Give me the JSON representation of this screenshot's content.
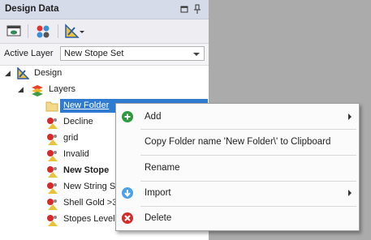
{
  "panel": {
    "title": "Design Data",
    "pin_icon": "pin-icon",
    "restore_icon": "restore-icon"
  },
  "toolbar": {
    "buttons": [
      "view-icon",
      "palette-icon",
      "design-tools-dropdown-icon"
    ]
  },
  "active_layer": {
    "label": "Active Layer",
    "value": "New Stope Set"
  },
  "tree": {
    "root": "Design",
    "layers": "Layers",
    "items": [
      "New Folder",
      "Decline",
      "grid",
      "Invalid",
      "New Stope",
      "New String Se",
      "Shell Gold >3",
      "Stopes Level"
    ]
  },
  "context_menu": {
    "add": "Add",
    "copy_folder": "Copy Folder name 'New Folder\\' to Clipboard",
    "rename": "Rename",
    "import": "Import",
    "delete": "Delete"
  },
  "colors": {
    "title_bar": "#d6dbe9",
    "selection": "#2e7bd1",
    "add_icon": "#2e9a3e",
    "import_icon": "#4aa3e8",
    "delete_icon": "#d62b2b"
  }
}
